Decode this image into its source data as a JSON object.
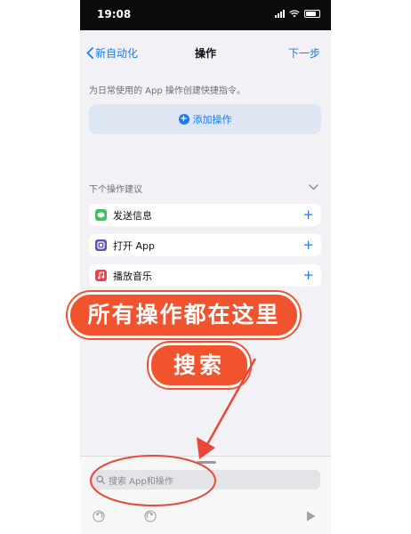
{
  "statusbar": {
    "time": "19:08"
  },
  "nav": {
    "back_label": "新自动化",
    "title": "操作",
    "next_label": "下一步"
  },
  "hint": "为日常使用的 App 操作创建快捷指令。",
  "add_action_label": "添加操作",
  "suggestions": {
    "header": "下个操作建议",
    "items": [
      {
        "label": "发送信息",
        "icon": "messages-icon",
        "color": "#34c759"
      },
      {
        "label": "打开 App",
        "icon": "open-app-icon",
        "color": "#5b4fd6"
      },
      {
        "label": "播放音乐",
        "icon": "music-icon",
        "color": "#fc3c44"
      }
    ]
  },
  "search": {
    "placeholder": "搜索 App和操作"
  },
  "overlay": {
    "line1": "所有操作都在这里",
    "line2": "搜索"
  },
  "colors": {
    "accent": "#1a7cf5",
    "overlay": "#f0532d",
    "annotation": "#e8473a"
  }
}
